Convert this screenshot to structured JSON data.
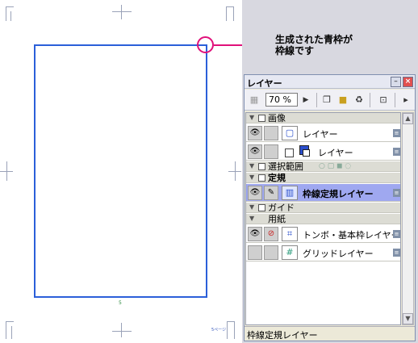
{
  "annotation": {
    "line1": "生成された青枠が",
    "line2": "枠線です"
  },
  "canvas": {
    "page_number": "5",
    "page_label": "5ページ"
  },
  "panel": {
    "title": "レイヤー",
    "minimize": "–",
    "close": "×",
    "zoom": "70 %",
    "colors": {
      "accent": "#2b5fd9",
      "annotation": "#e0107a",
      "selected_row": "#9fa8f0"
    },
    "groups": [
      {
        "label": "画像"
      },
      {
        "label": "選択範囲"
      },
      {
        "label": "定規"
      },
      {
        "label": "ガイド"
      },
      {
        "label": "用紙"
      }
    ],
    "layers": [
      {
        "name": "レイヤー"
      },
      {
        "name": "レイヤー"
      },
      {
        "name": "枠線定規レイヤー"
      },
      {
        "name": "トンボ・基本枠レイヤー"
      },
      {
        "name": "グリッドレイヤー"
      }
    ],
    "status": "枠線定規レイヤー"
  }
}
